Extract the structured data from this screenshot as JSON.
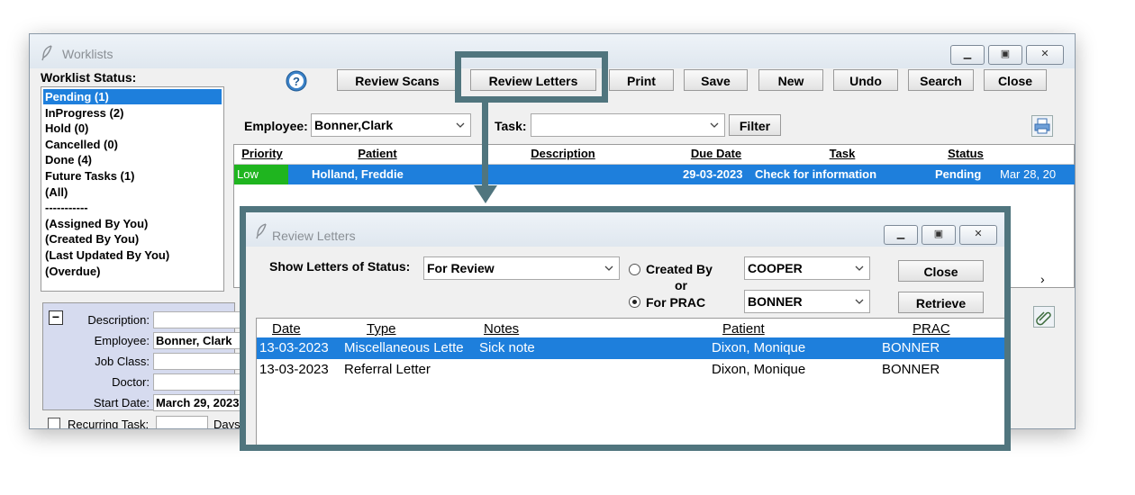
{
  "window": {
    "title": "Worklists",
    "toolbar": {
      "review_scans": "Review Scans",
      "review_letters": "Review Letters",
      "print": "Print",
      "save": "Save",
      "new": "New",
      "undo": "Undo",
      "search": "Search",
      "close": "Close"
    },
    "status_panel": {
      "label": "Worklist Status:",
      "items": [
        "Pending (1)",
        "InProgress (2)",
        "Hold (0)",
        "Cancelled (0)",
        "Done (4)",
        "Future Tasks (1)",
        "(All)",
        "-----------",
        "(Assigned By You)",
        "(Created By You)",
        "(Last Updated By You)",
        "(Overdue)"
      ],
      "selected_index": 0
    },
    "filter": {
      "employee_label": "Employee:",
      "employee_value": "Bonner,Clark",
      "task_label": "Task:",
      "task_value": "",
      "filter_button": "Filter"
    },
    "grid": {
      "columns": [
        "Priority",
        "Patient",
        "Description",
        "Due Date",
        "Task",
        "Status"
      ],
      "rows": [
        {
          "priority": "Low",
          "patient": "Holland, Freddie",
          "description": "",
          "due_date": "29-03-2023",
          "task": "Check for information",
          "status": "Pending",
          "extra": "Mar 28, 20"
        }
      ]
    },
    "details": {
      "collapse_symbol": "−",
      "description_label": "Description:",
      "description_value": "",
      "employee_label": "Employee:",
      "employee_value": "Bonner, Clark",
      "job_class_label": "Job Class:",
      "job_class_value": "",
      "doctor_label": "Doctor:",
      "doctor_value": "",
      "start_date_label": "Start Date:",
      "start_date_value": "March 29, 2023",
      "recurring_label": "Recurring Task:",
      "days_label": "Days"
    }
  },
  "popup": {
    "title": "Review Letters",
    "status_label": "Show Letters of Status:",
    "status_value": "For Review",
    "created_by_label": "Created By",
    "or_label": "or",
    "for_prac_label": "For PRAC",
    "created_by_value": "COOPER",
    "for_prac_value": "BONNER",
    "selected_radio": "For PRAC",
    "close_button": "Close",
    "retrieve_button": "Retrieve",
    "columns": [
      "Date",
      "Type",
      "Notes",
      "Patient",
      "PRAC"
    ],
    "rows": [
      {
        "date": "13-03-2023",
        "type": "Miscellaneous Lette",
        "notes": "Sick note",
        "patient": "Dixon, Monique",
        "prac": "BONNER"
      },
      {
        "date": "13-03-2023",
        "type": "Referral Letter",
        "notes": "",
        "patient": "Dixon, Monique",
        "prac": "BONNER"
      }
    ],
    "selected_row": 0
  },
  "colors": {
    "highlight_blue": "#1e7fdc",
    "callout_teal": "#50757e",
    "priority_low_green": "#1fb51f"
  },
  "icons": [
    "feather-icon",
    "help-icon",
    "printer-icon",
    "attach-icon",
    "minimize-icon",
    "maximize-icon",
    "close-icon",
    "chevron-down-icon",
    "chevron-right-icon"
  ]
}
